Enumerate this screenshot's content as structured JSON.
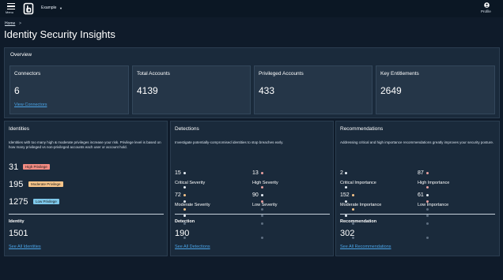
{
  "header": {
    "menu_label": "Menu",
    "workspace": "Example",
    "profile_label": "Profile"
  },
  "breadcrumb": {
    "home": "Home",
    "sep": ">"
  },
  "page_title": "Identity Security Insights",
  "overview": {
    "title": "Overview",
    "cards": [
      {
        "label": "Connectors",
        "value": "6",
        "link": "View Connectors"
      },
      {
        "label": "Total Accounts",
        "value": "4139"
      },
      {
        "label": "Privileged Accounts",
        "value": "433"
      },
      {
        "label": "Key Entitlements",
        "value": "2649"
      }
    ]
  },
  "identities": {
    "title": "Identities",
    "description": "Identities with too many high & moderate privileges increase your risk. Privilege level is based on how many privileged vs non-privileged accounts each user or account hold.",
    "rows": [
      {
        "value": "31",
        "badge": "High Privilege",
        "color": "#f28b82"
      },
      {
        "value": "195",
        "badge": "Moderate Privilege",
        "color": "#f7c58a"
      },
      {
        "value": "1275",
        "badge": "Low Privilege",
        "color": "#7ec8ea"
      }
    ],
    "total_label": "Identity",
    "total_value": "1501",
    "link": "See All Identities"
  },
  "detections": {
    "title": "Detections",
    "description": "Investigate potentially-compromised identities to stop breaches early.",
    "metrics": [
      {
        "value": "15",
        "label": "Critical Severity",
        "filled": 4
      },
      {
        "value": "13",
        "label": "High Severity",
        "filled": 3
      },
      {
        "value": "72",
        "label": "Moderate Severity",
        "filled": 2
      },
      {
        "value": "90",
        "label": "Low Severity",
        "filled": 1
      }
    ],
    "total_label": "Detection",
    "total_value": "190",
    "link": "See All Detections"
  },
  "recommendations": {
    "title": "Recommendations",
    "description": "Addressing critical and high importance recommendations greatly improves your security posture.",
    "metrics": [
      {
        "value": "2",
        "label": "Critical Importance",
        "filled": 4
      },
      {
        "value": "87",
        "label": "High Importance",
        "filled": 3
      },
      {
        "value": "152",
        "label": "Moderate Importance",
        "filled": 2
      },
      {
        "value": "61",
        "label": "Low Importance",
        "filled": 1
      }
    ],
    "total_label": "Recommendation",
    "total_value": "302",
    "link": "See All Recommendations"
  },
  "colors": {
    "link": "#4aa3e6",
    "dot_filled_identity": "#e6edf5",
    "dot_critical": "#e6edf5",
    "dot_empty": "#5d6e80"
  }
}
